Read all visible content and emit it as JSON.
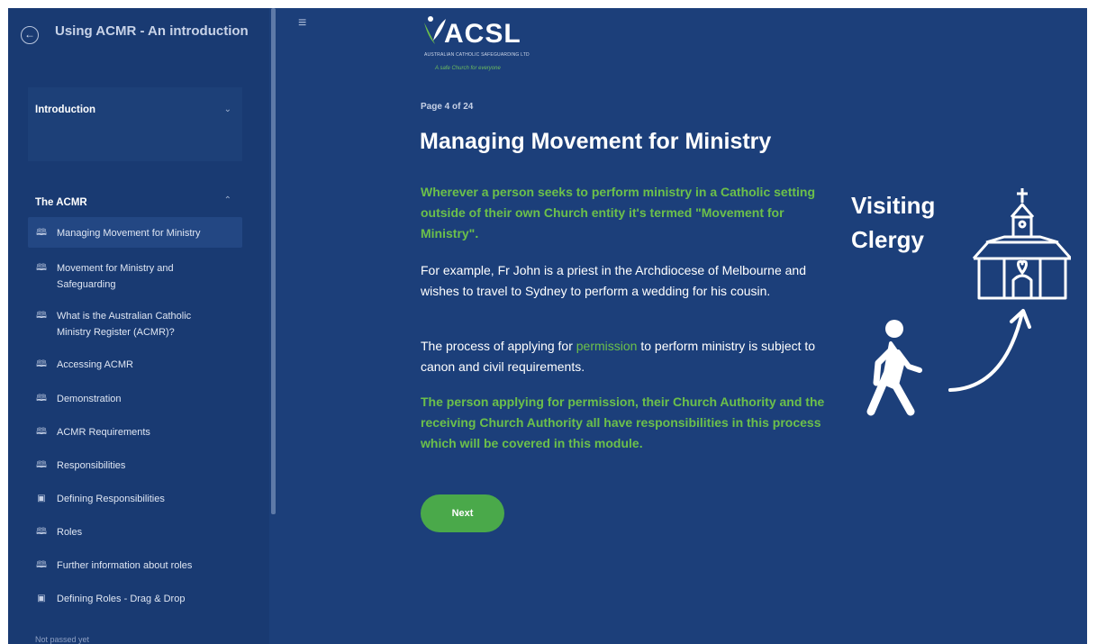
{
  "sidebar": {
    "course_title": "Using ACMR - An introduction",
    "back_icon": "arrow-left-circle-icon",
    "sections": [
      {
        "label": "Introduction",
        "chevron": "chevron-down-icon",
        "expanded": false
      },
      {
        "label": "The ACMR",
        "chevron": "chevron-up-icon",
        "expanded": true
      }
    ],
    "items": [
      {
        "label": "Managing Movement for Ministry",
        "icon": "book-icon",
        "active": true
      },
      {
        "label": "Movement for Ministry and Safeguarding",
        "icon": "book-icon"
      },
      {
        "label": "What is the Australian Catholic Ministry Register (ACMR)?",
        "icon": "book-icon"
      },
      {
        "label": "Accessing ACMR",
        "icon": "book-icon"
      },
      {
        "label": "Demonstration",
        "icon": "book-icon"
      },
      {
        "label": "ACMR Requirements",
        "icon": "book-icon"
      },
      {
        "label": "Responsibilities",
        "icon": "book-icon"
      },
      {
        "label": "Defining Responsibilities",
        "icon": "quiz-icon"
      },
      {
        "label": "Roles",
        "icon": "book-icon"
      },
      {
        "label": "Further information about roles",
        "icon": "book-icon"
      },
      {
        "label": "Defining Roles - Drag & Drop",
        "icon": "quiz-icon"
      }
    ],
    "footer": "Not passed yet"
  },
  "main": {
    "logo": {
      "text": "ACSL",
      "sub": "AUSTRALIAN CATHOLIC SAFEGUARDING LTD",
      "tagline": "A safe Church for everyone"
    },
    "page_indicator": "Page 4 of 24",
    "title": "Managing Movement for Ministry",
    "intro": "Wherever a person seeks to perform ministry in a Catholic setting outside of their own Church entity it's termed \"Movement for Ministry\".",
    "example": "For example, Fr John is a priest in the Archdiocese of Melbourne and wishes to travel to Sydney to perform a wedding for his cousin.",
    "process_before": "The process of applying for ",
    "process_highlight": "permission",
    "process_after": " to perform ministry is subject to canon and civil requirements.",
    "closing": "The person applying for permission, their Church Authority and the receiving Church Authority all have responsibilities in this process which will be covered in this module.",
    "next_label": "Next",
    "illustration": {
      "label_line1": "Visiting",
      "label_line2": "Clergy",
      "icons": [
        "walking-person-icon",
        "curved-arrow-icon",
        "church-icon"
      ]
    }
  },
  "colors": {
    "background": "#1c3f7a",
    "sidebar": "#193a72",
    "accent_green": "#6cc04a",
    "button_green": "#4aa94a"
  }
}
